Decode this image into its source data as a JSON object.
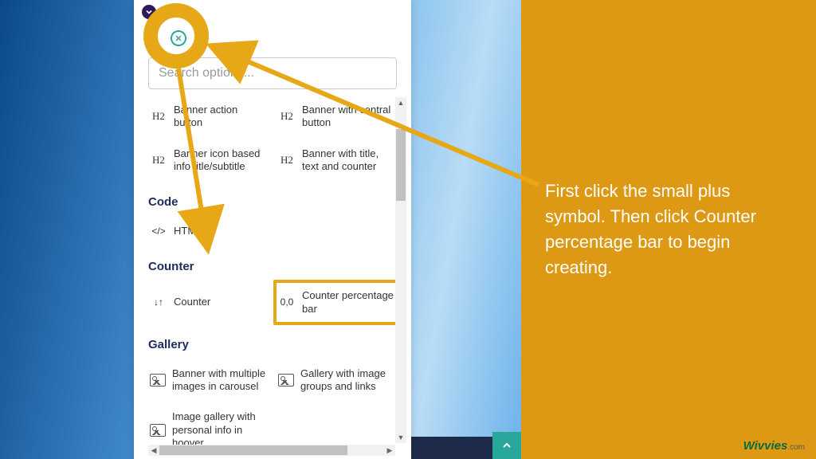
{
  "annotation": {
    "instruction": "First click the small plus symbol. Then click Counter percentage bar to begin creating."
  },
  "panel": {
    "search_placeholder": "Search options...",
    "sections": {
      "banner": {
        "item1": "Banner action button",
        "item2": "Banner with central button",
        "item3": "Banner icon based info title/subtitle",
        "item4": "Banner with title, text and counter"
      },
      "code_title": "Code",
      "code": {
        "html": "HTML"
      },
      "counter_title": "Counter",
      "counter": {
        "item1": "Counter",
        "item2": "Counter percentage bar"
      },
      "gallery_title": "Gallery",
      "gallery": {
        "item1": "Banner with multiple images in carousel",
        "item2": "Gallery with image groups and links",
        "item3": "Image gallery with personal info in hoover"
      }
    }
  },
  "icons": {
    "h2": "H2",
    "code": "</>",
    "sort": "↓↑",
    "decimal": "0,0"
  },
  "watermark": {
    "brand": "Wivvies",
    "tld": ".com"
  }
}
